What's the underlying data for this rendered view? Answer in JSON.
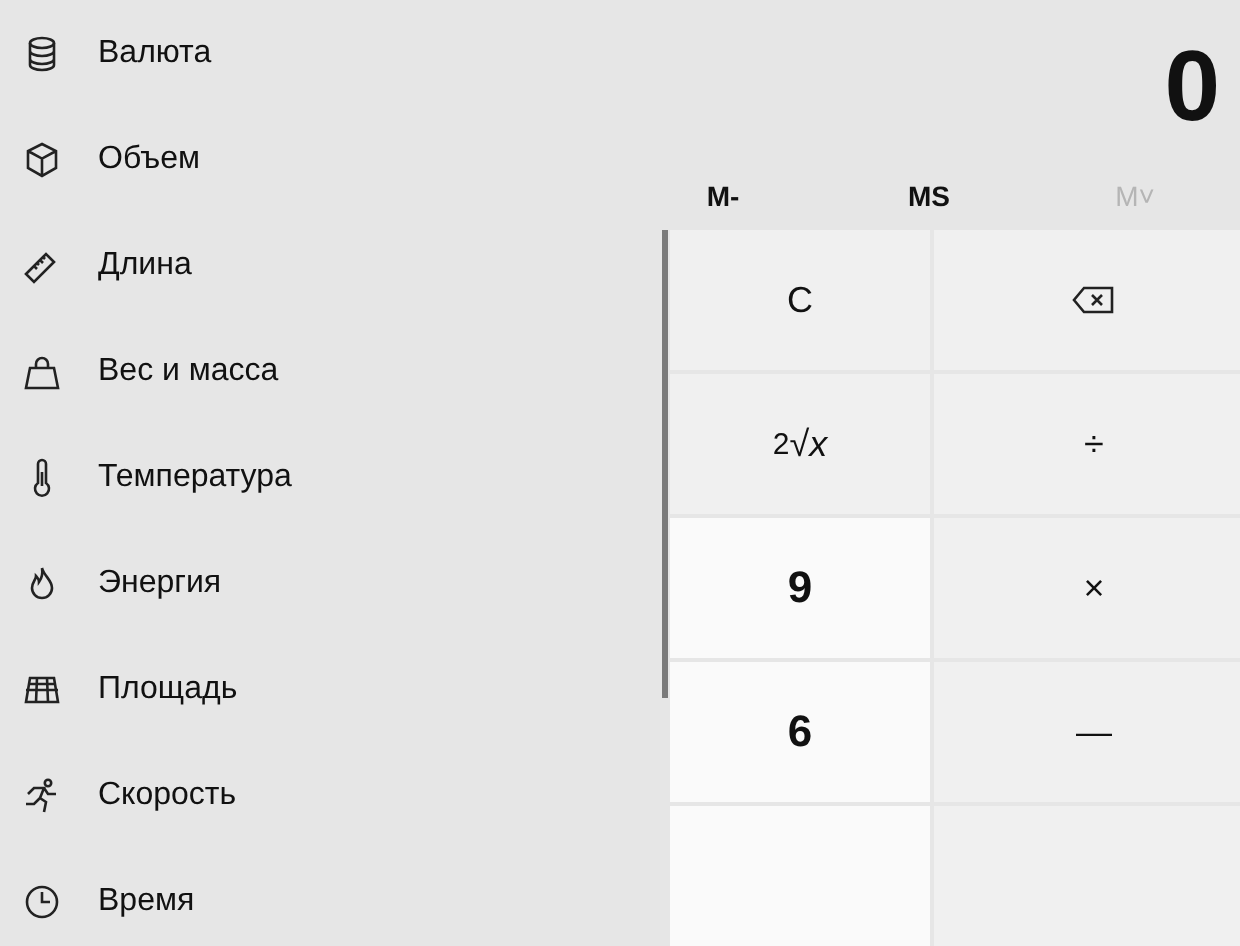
{
  "sidebar": {
    "items": [
      {
        "label": "Валюта"
      },
      {
        "label": "Объем"
      },
      {
        "label": "Длина"
      },
      {
        "label": "Вес и масса"
      },
      {
        "label": "Температура"
      },
      {
        "label": "Энергия"
      },
      {
        "label": "Площадь"
      },
      {
        "label": "Скорость"
      },
      {
        "label": "Время"
      }
    ]
  },
  "display": {
    "value": "0"
  },
  "memory": [
    {
      "label": "M-",
      "disabled": false
    },
    {
      "label": "MS",
      "disabled": false
    },
    {
      "label": "M˅",
      "disabled": true
    }
  ],
  "keys": [
    {
      "kind": "op",
      "label": "C"
    },
    {
      "kind": "backspace"
    },
    {
      "kind": "op",
      "label": "$^{2}$√*x*"
    },
    {
      "kind": "op",
      "label": "÷"
    },
    {
      "kind": "digit",
      "label": "9"
    },
    {
      "kind": "op",
      "label": "×"
    },
    {
      "kind": "digit",
      "label": "6"
    },
    {
      "kind": "op",
      "label": "—"
    },
    {
      "kind": "digit"
    },
    {
      "kind": "op"
    }
  ]
}
